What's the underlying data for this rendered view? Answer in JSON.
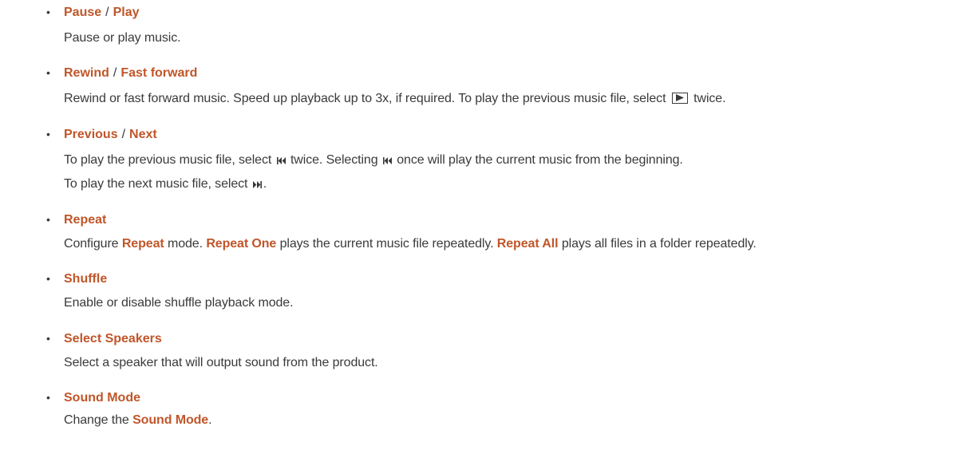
{
  "items": [
    {
      "term_a": "Pause",
      "separator": "/",
      "term_b": "Play",
      "desc": "Pause or play music."
    },
    {
      "term_a": "Rewind",
      "separator": "/",
      "term_b": "Fast forward",
      "desc_pre": "Rewind or fast forward music. Speed up playback up to 3x, if required. To play the previous music file, select",
      "desc_post": "twice.",
      "inline_icon": "play-button-icon"
    },
    {
      "term_a": "Previous",
      "separator": "/",
      "term_b": "Next",
      "line1_pre": "To play the previous music file, select",
      "line1_mid": "twice. Selecting",
      "line1_post": "once will play the current music from the beginning.",
      "line2_pre": "To play the next music file, select",
      "line2_post": ".",
      "icons": [
        "previous-track-icon",
        "next-track-icon"
      ]
    },
    {
      "term": "Repeat",
      "desc_1": "Configure",
      "kw_1": "Repeat",
      "desc_2": "mode.",
      "kw_2": "Repeat One",
      "desc_3": "plays the current music file repeatedly.",
      "kw_3": "Repeat All",
      "desc_4": "plays all files in a folder repeatedly."
    },
    {
      "term": "Shuffle",
      "desc": "Enable or disable shuffle playback mode."
    },
    {
      "term": "Select Speakers",
      "desc": "Select a speaker that will output sound from the product."
    },
    {
      "term": "Sound Mode",
      "desc_pre": "Change the",
      "kw": "Sound Mode",
      "desc_post": "."
    }
  ],
  "bullet_char": "•",
  "colors": {
    "keyword": "#c0562a",
    "text": "#3a3a3a"
  }
}
